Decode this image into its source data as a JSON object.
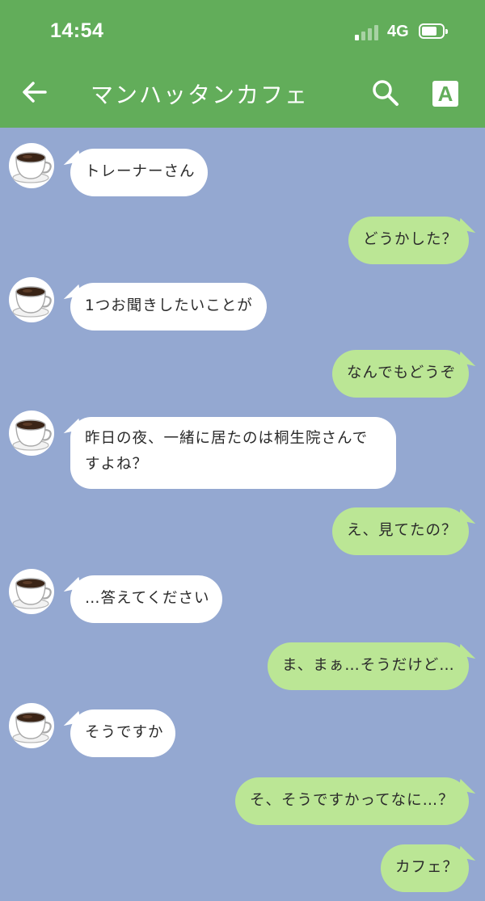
{
  "status_bar": {
    "time": "14:54",
    "network": "4G",
    "signal_bars": 1,
    "signal_total": 4,
    "battery_level": 0.7
  },
  "header": {
    "title": "マンハッタンカフェ",
    "back_icon": "arrow-left-icon",
    "search_icon": "search-icon",
    "translate_label": "A",
    "background_color": "#62ad5a"
  },
  "chat": {
    "background_color": "#94a8d1",
    "incoming_color": "#ffffff",
    "outgoing_color": "#bbe695",
    "avatar_icon": "coffee-cup-icon",
    "messages": [
      {
        "side": "in",
        "lines": [
          "トレーナーさん"
        ]
      },
      {
        "side": "out",
        "lines": [
          "どうかした？"
        ]
      },
      {
        "side": "in",
        "lines": [
          "1つお聞きしたいことが"
        ]
      },
      {
        "side": "out",
        "lines": [
          "なんでもどうぞ"
        ]
      },
      {
        "side": "in",
        "lines": [
          "昨日の夜、一緒に居たのは桐生院さんで",
          "すよね？"
        ]
      },
      {
        "side": "out",
        "lines": [
          "え、見てたの？"
        ]
      },
      {
        "side": "in",
        "lines": [
          "…答えてください"
        ]
      },
      {
        "side": "out",
        "lines": [
          "ま、まぁ…そうだけど…"
        ]
      },
      {
        "side": "in",
        "lines": [
          "そうですか"
        ]
      },
      {
        "side": "out",
        "lines": [
          "そ、そうですかってなに…？"
        ]
      },
      {
        "side": "out",
        "lines": [
          "カフェ？"
        ]
      }
    ]
  }
}
